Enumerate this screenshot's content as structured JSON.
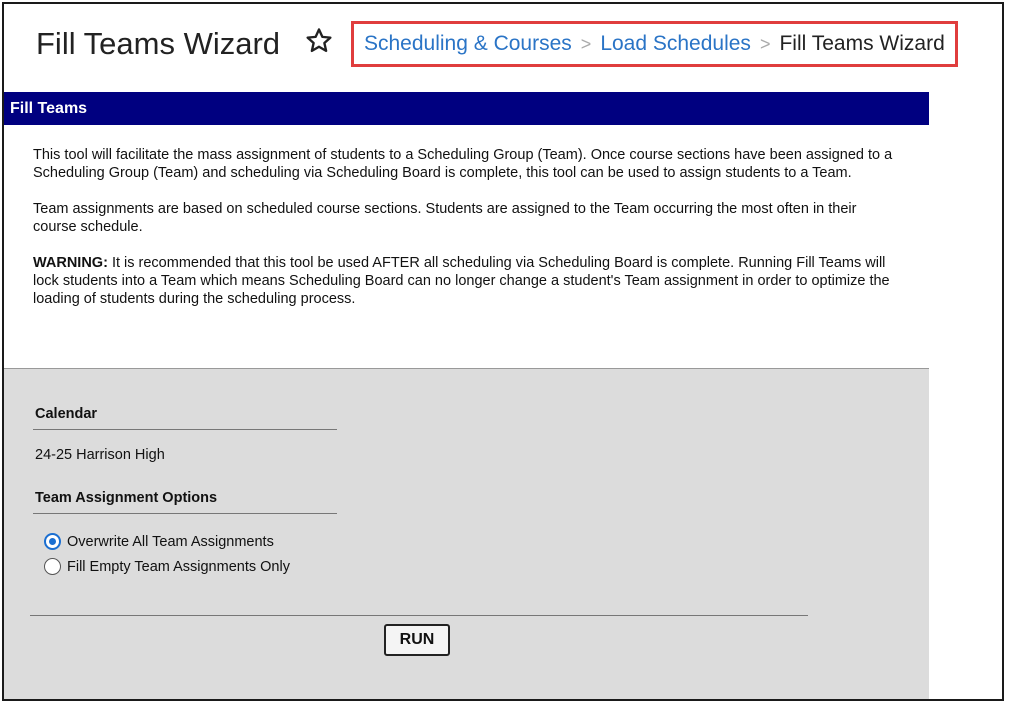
{
  "header": {
    "title": "Fill Teams Wizard",
    "star_icon": "star-outline-icon",
    "breadcrumb": {
      "items": [
        "Scheduling & Courses",
        "Load Schedules"
      ],
      "current": "Fill Teams Wizard",
      "separator": ">"
    }
  },
  "section": {
    "title": "Fill Teams",
    "bar_color": "#000080"
  },
  "description": {
    "paragraph1": "This tool will facilitate the mass assignment of students to a Scheduling Group (Team). Once course sections have been assigned to a Scheduling Group (Team) and scheduling via Scheduling Board is complete, this tool can be used to assign students to a Team.",
    "paragraph2": "Team assignments are based on scheduled course sections. Students are assigned to the Team occurring the most often in their course schedule.",
    "warning_label": "WARNING:",
    "warning_text": " It is recommended that this tool be used AFTER all scheduling via Scheduling Board is complete. Running Fill Teams will lock students into a Team which means Scheduling Board can no longer change a student's Team assignment in order to optimize the loading of students during the scheduling process."
  },
  "form": {
    "calendar_label": "Calendar",
    "calendar_value": "24-25 Harrison High",
    "options_label": "Team Assignment Options",
    "options": [
      {
        "label": "Overwrite All Team Assignments",
        "checked": true
      },
      {
        "label": "Fill Empty Team Assignments Only",
        "checked": false
      }
    ],
    "run_label": "RUN"
  },
  "colors": {
    "link": "#2a74c6",
    "highlight_border": "#e03d3d",
    "radio_selected": "#1b6fd1"
  }
}
